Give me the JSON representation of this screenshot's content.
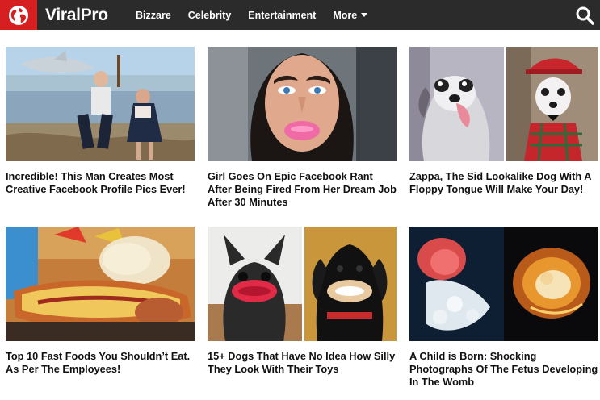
{
  "site": {
    "brand": "ViralPro",
    "brand_color": "#d71f22",
    "nav_bg": "#2b2b2b",
    "logo_icon": "globe-icon"
  },
  "nav": {
    "items": [
      "Bizzare",
      "Celebrity",
      "Entertainment"
    ],
    "more_label": "More",
    "more_icon": "caret-down-icon",
    "search_icon": "search-icon"
  },
  "articles": [
    {
      "title": "Incredible! This Man Creates Most Creative Facebook Profile Pics Ever!"
    },
    {
      "title": "Girl Goes On Epic Facebook Rant After Being Fired From Her Dream Job After 30 Minutes"
    },
    {
      "title": "Zappa, The Sid Lookalike Dog With A Floppy Tongue Will Make Your Day!"
    },
    {
      "title": "Top 10 Fast Foods You Shouldn’t Eat. As Per The Employees!"
    },
    {
      "title": "15+ Dogs That Have No Idea How Silly They Look With Their Toys"
    },
    {
      "title": "A Child is Born: Shocking Photographs Of The Fetus Developing In The Womb"
    }
  ]
}
